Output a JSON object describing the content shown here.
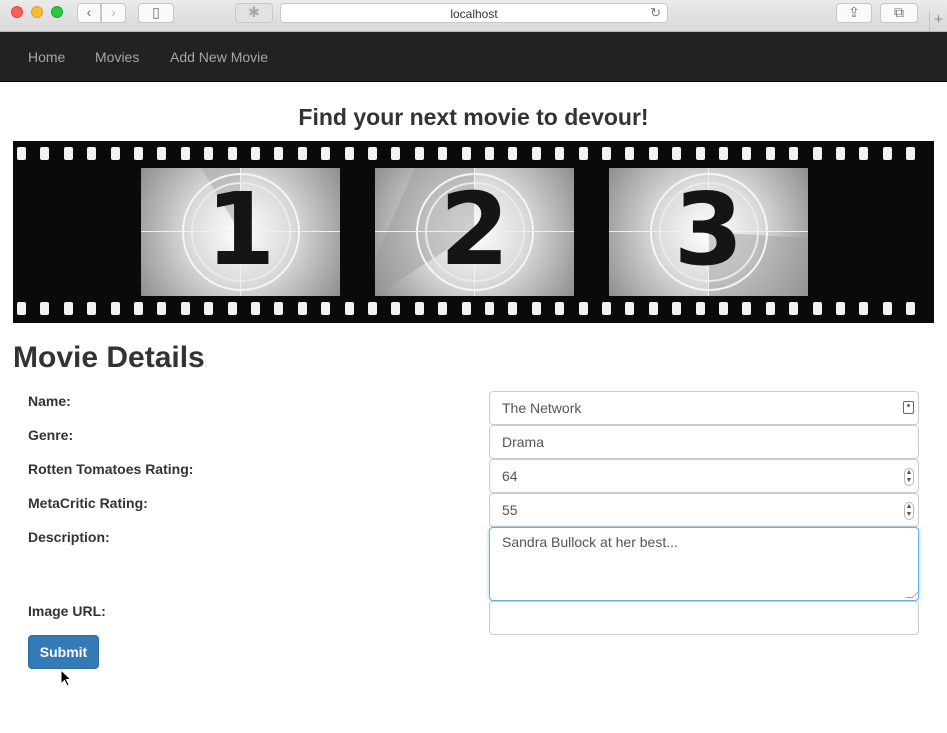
{
  "browser": {
    "address": "localhost",
    "icons": {
      "back": "chevron-left-icon",
      "forward": "chevron-right-icon",
      "sidebar": "sidebar-icon",
      "extension": "puzzle-icon",
      "reload": "reload-icon",
      "share": "share-icon",
      "tabs": "tabs-icon",
      "new_tab": "plus-icon"
    }
  },
  "navbar": {
    "items": [
      {
        "label": "Home"
      },
      {
        "label": "Movies"
      },
      {
        "label": "Add New Movie"
      }
    ],
    "background": "#222222",
    "link_color": "#a6a6a6"
  },
  "main": {
    "tagline": "Find your next movie to devour!",
    "banner_digits": [
      "1",
      "2",
      "3"
    ],
    "section_title": "Movie Details"
  },
  "form": {
    "fields": [
      {
        "label": "Name:",
        "value": "The Network"
      },
      {
        "label": "Genre:",
        "value": "Drama"
      },
      {
        "label": "Rotten Tomatoes Rating:",
        "value": "64"
      },
      {
        "label": "MetaCritic Rating:",
        "value": "55"
      },
      {
        "label": "Description:",
        "value": "Sandra Bullock at her best..."
      },
      {
        "label": "Image URL:",
        "value": ""
      }
    ],
    "submit_label": "Submit",
    "submit_color": "#337ab7",
    "focus_color": "#66afe9"
  }
}
